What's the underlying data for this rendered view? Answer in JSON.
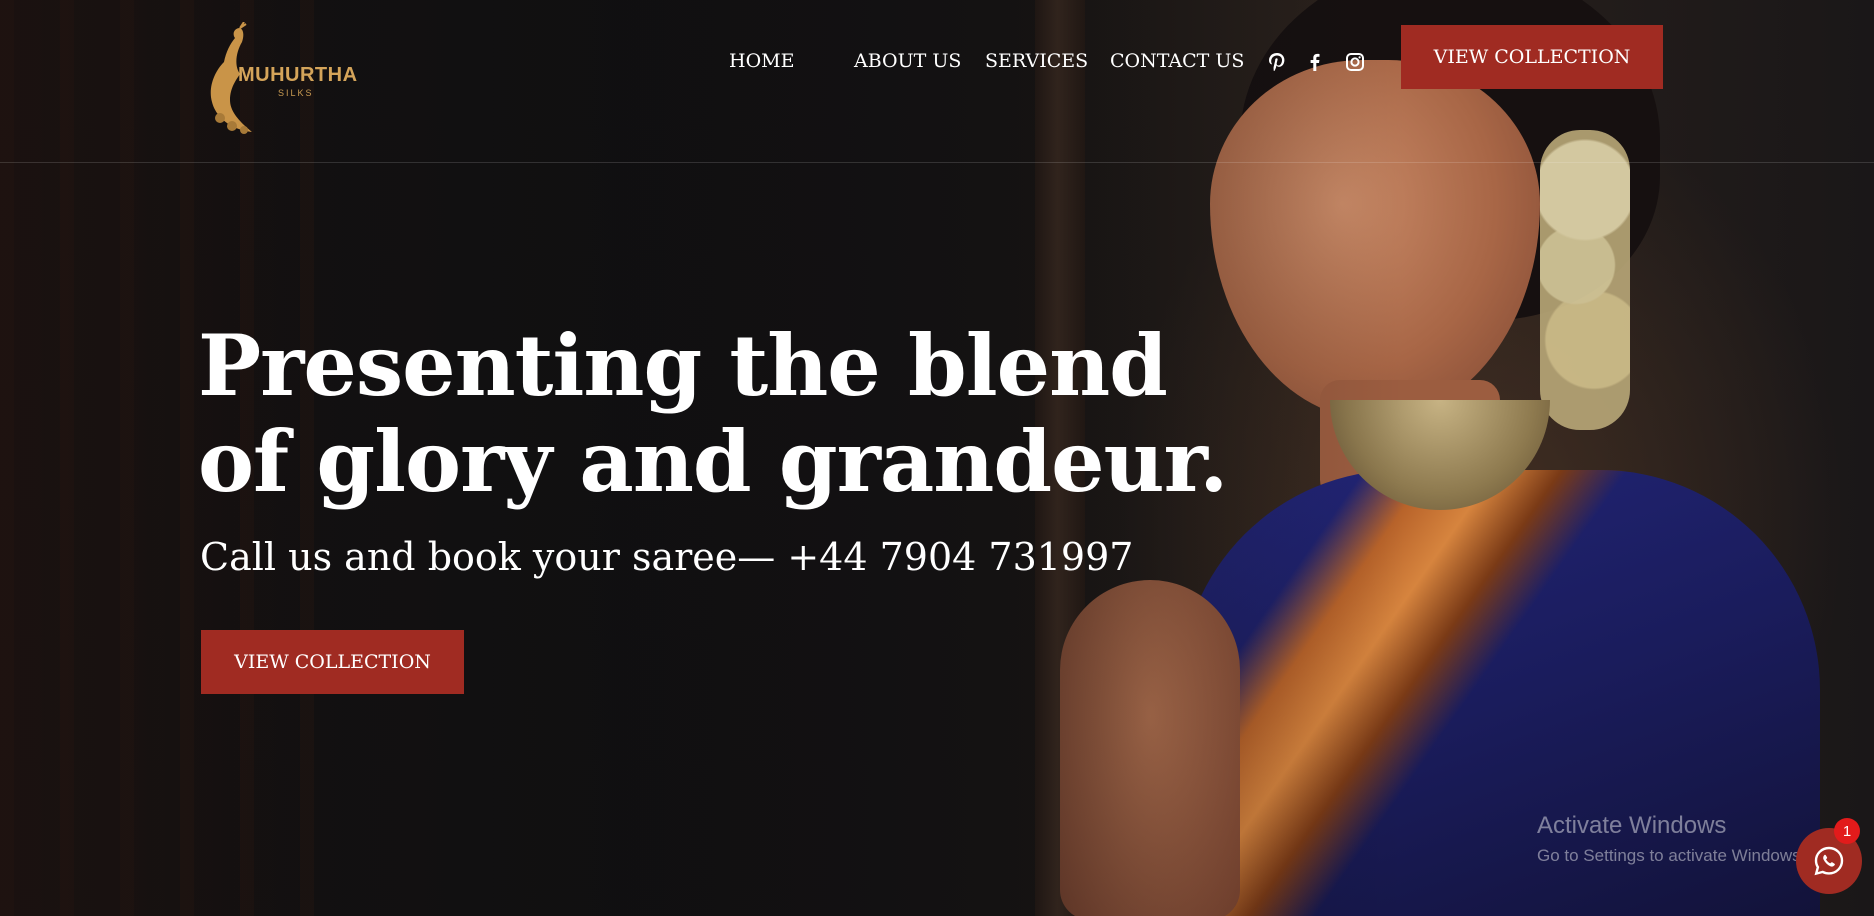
{
  "brand": {
    "name": "MUHURTHA",
    "tagline": "SILKS",
    "accent": "#a02b22",
    "gold": "#d4a45a"
  },
  "nav": {
    "items": [
      {
        "label": "HOME"
      },
      {
        "label": "ABOUT US"
      },
      {
        "label": "SERVICES"
      },
      {
        "label": "CONTACT US"
      }
    ],
    "social": [
      "pinterest-icon",
      "facebook-icon",
      "instagram-icon"
    ],
    "cta_label": "VIEW COLLECTION"
  },
  "hero": {
    "headline_line1": "Presenting the blend",
    "headline_line2": "of glory and grandeur.",
    "subline": "Call us and book your saree— +44 7904 731997",
    "cta_label": "VIEW COLLECTION"
  },
  "watermark": {
    "title": "Activate Windows",
    "subtitle": "Go to Settings to activate Windows."
  },
  "chat": {
    "icon": "whatsapp-icon",
    "badge_count": "1"
  }
}
